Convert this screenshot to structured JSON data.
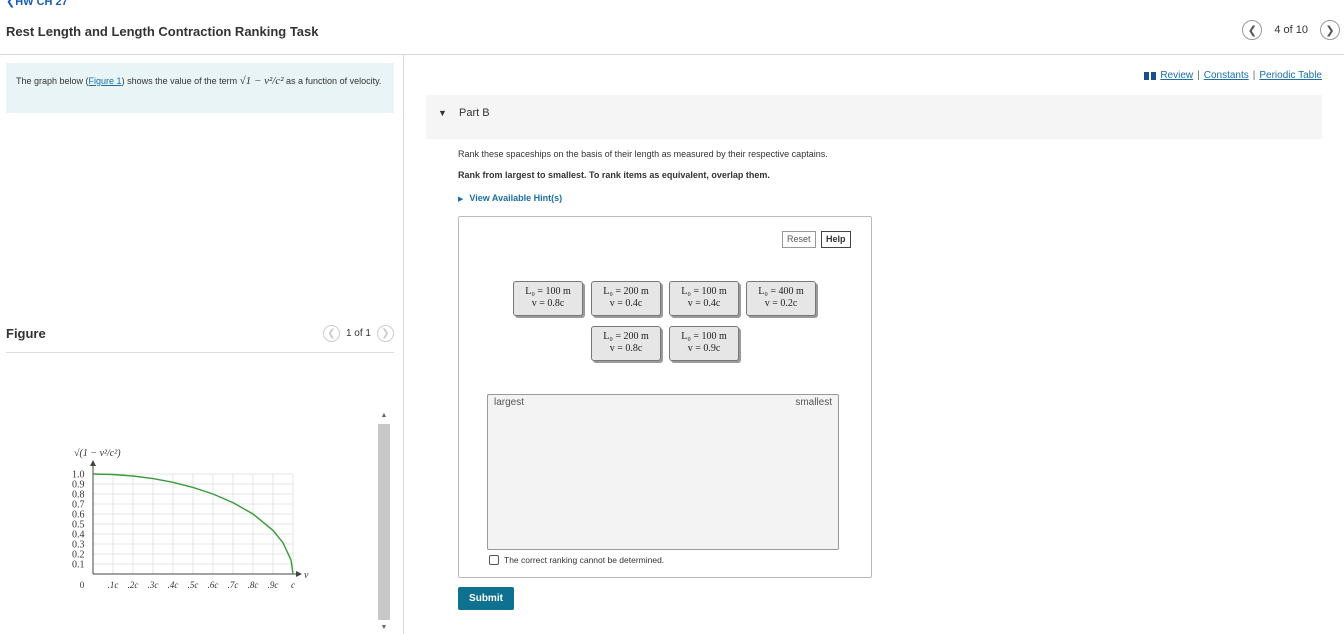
{
  "header": {
    "breadcrumb": "❮HW CH 27",
    "title": "Rest Length and Length Contraction Ranking Task",
    "pager": {
      "count": "4 of 10",
      "prev": "❮",
      "next": "❯"
    }
  },
  "links": {
    "review": "Review",
    "constants": "Constants",
    "periodic_table": "Periodic Table",
    "sep": "|"
  },
  "intro": {
    "text_before": "The graph below (",
    "figure_link": "Figure 1",
    "text_mid": ") shows the value of the term ",
    "term": "√1 − v²/c²",
    "text_after": " as a function of velocity."
  },
  "figure": {
    "title": "Figure",
    "count": "1 of 1",
    "prev": "❮",
    "next": "❯"
  },
  "chart_data": {
    "type": "line",
    "title": "",
    "ylabel": "√(1 − v²/c²)",
    "xlabel": "v",
    "x_tick_labels": [
      "0",
      ".1c",
      ".2c",
      ".3c",
      ".4c",
      ".5c",
      ".6c",
      ".7c",
      ".8c",
      ".9c",
      "c"
    ],
    "y_tick_labels": [
      "1.0",
      "0.9",
      "0.8",
      "0.7",
      "0.6",
      "0.5",
      "0.4",
      "0.3",
      "0.2",
      "0.1"
    ],
    "xlim": [
      0,
      1
    ],
    "ylim": [
      0,
      1
    ],
    "grid": true,
    "series": [
      {
        "color": "#3a9a3a",
        "x": [
          0,
          0.1,
          0.2,
          0.3,
          0.4,
          0.5,
          0.6,
          0.7,
          0.8,
          0.9,
          0.95,
          0.99,
          1.0
        ],
        "y": [
          1.0,
          0.995,
          0.98,
          0.954,
          0.917,
          0.866,
          0.8,
          0.714,
          0.6,
          0.436,
          0.312,
          0.141,
          0.0
        ]
      }
    ]
  },
  "part": {
    "toggle": "▼",
    "label": "Part B"
  },
  "instruction": "Rank these spaceships on the basis of their length as measured by their respective captains.",
  "rank_note": "Rank from largest to smallest. To rank items as equivalent, overlap them.",
  "hints": {
    "caret": "▶",
    "label": "View Available Hint(s)"
  },
  "panel": {
    "reset": "Reset",
    "help": "Help",
    "tiles": [
      {
        "L": "L₀ = 100 m",
        "v": "v = 0.8c"
      },
      {
        "L": "L₀ = 200 m",
        "v": "v = 0.4c"
      },
      {
        "L": "L₀ = 100 m",
        "v": "v = 0.4c"
      },
      {
        "L": "L₀ = 400 m",
        "v": "v = 0.2c"
      },
      {
        "L": "L₀ = 200 m",
        "v": "v = 0.8c"
      },
      {
        "L": "L₀ = 100 m",
        "v": "v = 0.9c"
      }
    ],
    "largest": "largest",
    "smallest": "smallest",
    "cannot_determine": "The correct ranking cannot be determined."
  },
  "submit": "Submit"
}
